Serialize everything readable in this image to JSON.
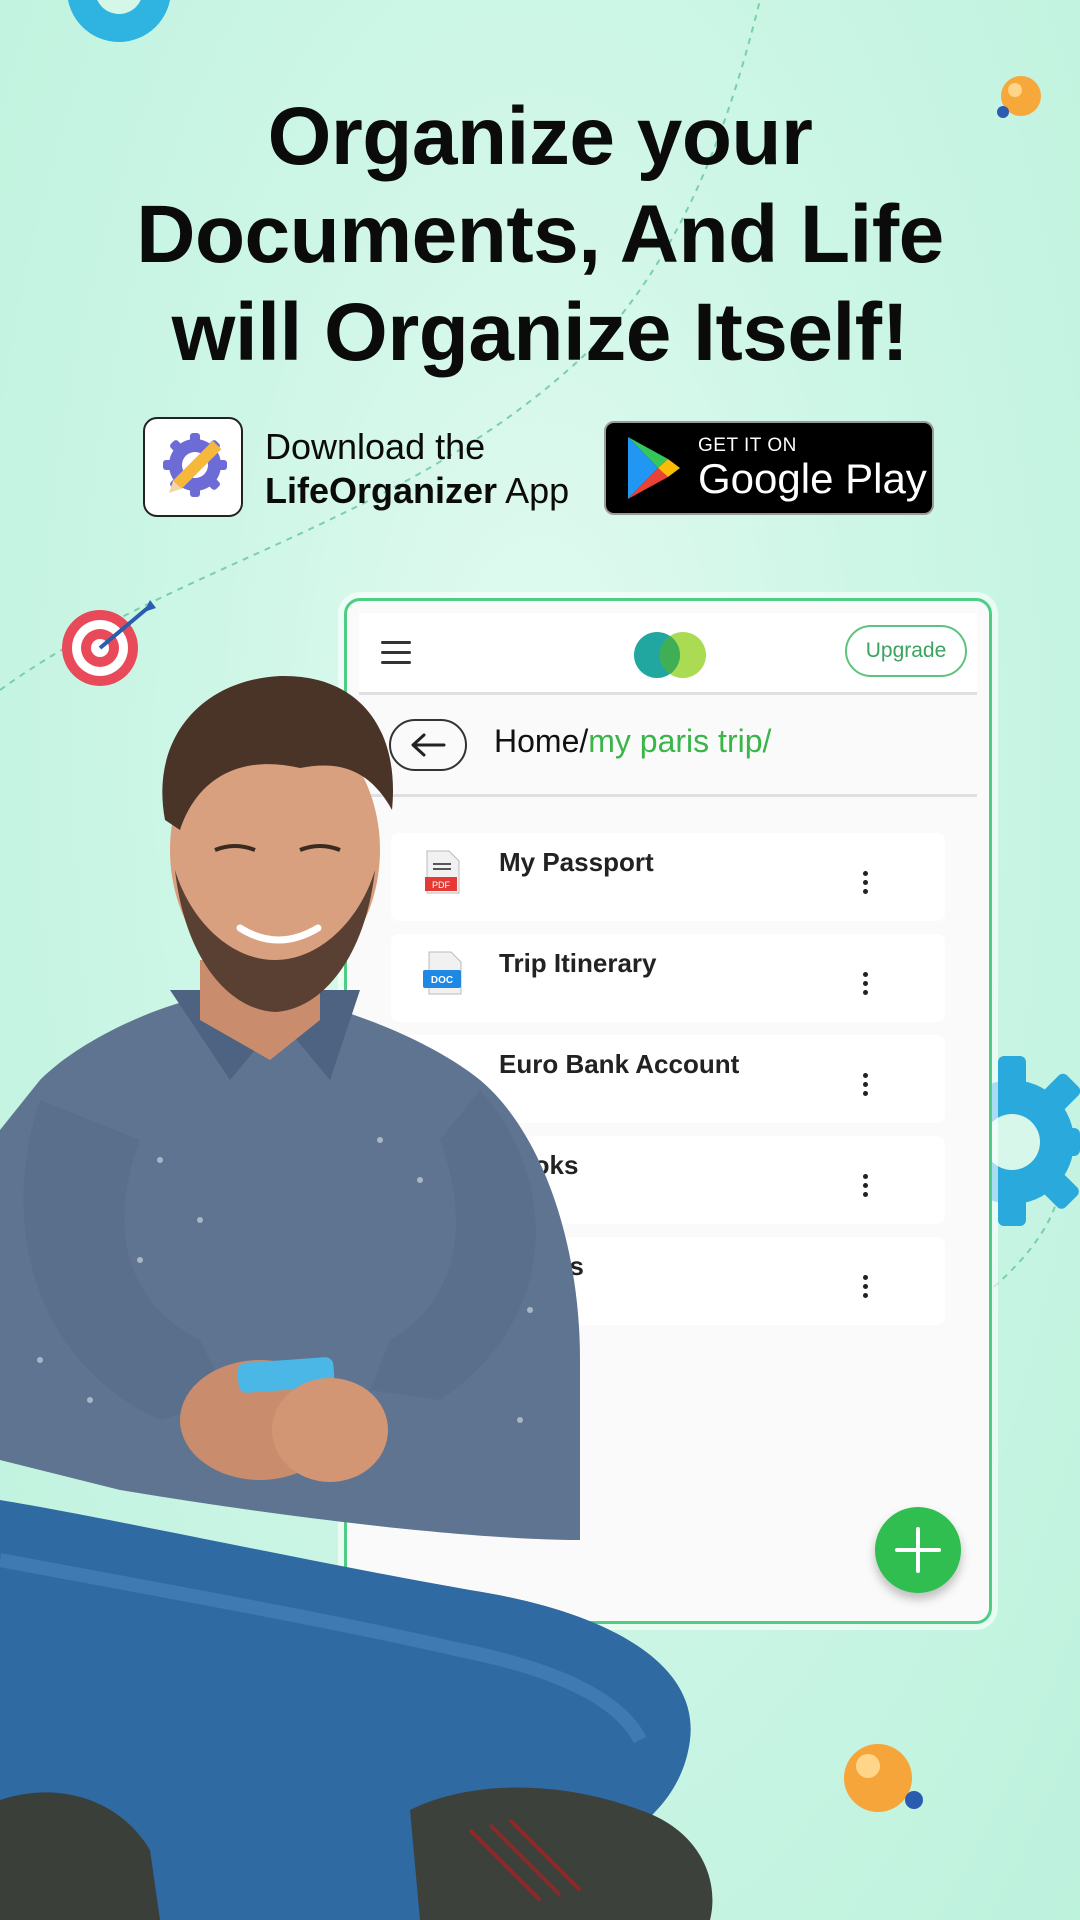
{
  "headline": {
    "line1": "Organize your",
    "line2": "Documents, And Life",
    "line3": "will Organize Itself!"
  },
  "download": {
    "prefix": "Download the",
    "app_name": "LifeOrganizer",
    "suffix": "App"
  },
  "store_badge": {
    "small": "GET IT ON",
    "big": "Google Play"
  },
  "app": {
    "upgrade_label": "Upgrade",
    "breadcrumb_home": "Home/",
    "breadcrumb_current": "my paris trip/",
    "files": [
      {
        "name": "My Passport",
        "icon": "pdf-file-icon",
        "icon_label": "PDF"
      },
      {
        "name": "Trip Itinerary",
        "icon": "doc-file-icon",
        "icon_label": "DOC"
      },
      {
        "name": "Euro Bank Account",
        "icon": "folder-icon"
      },
      {
        "name": "Books",
        "icon": "folder-icon"
      },
      {
        "name": "Videos",
        "icon": "folder-icon"
      }
    ]
  },
  "colors": {
    "accent_green": "#3ab54a",
    "card_border": "#4ccf83",
    "fab": "#2fbe4f",
    "gear_blue": "#2fb3e0"
  }
}
